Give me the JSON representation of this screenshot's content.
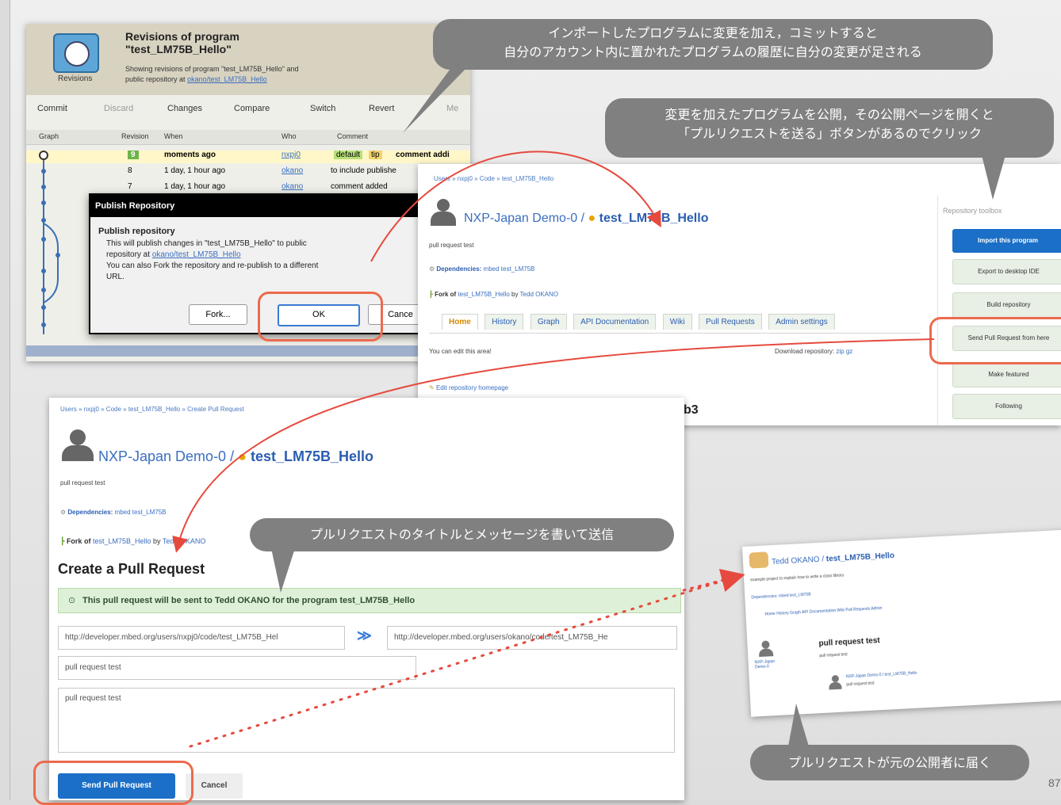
{
  "colors": {
    "accent": "#1b6fc7",
    "highlight": "#ec6a4d",
    "callout": "#808080",
    "success_bg": "#dff0d8"
  },
  "page_number": "87",
  "callouts": {
    "c1": "インポートしたプログラムに変更を加え，コミットすると\n自分のアカウント内に置かれたプログラムの履歴に自分の変更が足される",
    "c2": "変更を加えたプログラムを公開，その公開ページを開くと\n「プルリクエストを送る」ボタンがあるのでクリック",
    "c3": "プルリクエストのタイトルとメッセージを書いて送信",
    "c4": "プルリクエストが元の公開者に届く"
  },
  "revisions_window": {
    "caption": "Revisions",
    "title_line1": "Revisions of program",
    "title_line2": "\"test_LM75B_Hello\"",
    "desc_line1": "Showing revisions of program \"test_LM75B_Hello\" and",
    "desc_line2": "public repository at",
    "desc_link": "okano/test_LM75B_Hello",
    "toolbar": [
      "Commit",
      "Discard",
      "Changes",
      "Compare",
      "Switch",
      "Revert",
      "Me"
    ],
    "columns": [
      "Graph",
      "Revision",
      "When",
      "Who",
      "Comment"
    ],
    "rows": [
      {
        "rev": "9",
        "when": "moments ago",
        "who": "nxpj0",
        "comment": "comment addi",
        "tags": [
          "default",
          "tip"
        ]
      },
      {
        "rev": "8",
        "when": "1 day, 1 hour ago",
        "who": "okano",
        "comment": "to include publishe"
      },
      {
        "rev": "7",
        "when": "1 day, 1 hour ago",
        "who": "okano",
        "comment": "comment added"
      }
    ]
  },
  "publish_dialog": {
    "titlebar": "Publish Repository",
    "heading": "Publish repository",
    "text1": "This will publish changes in \"test_LM75B_Hello\" to public",
    "text2": "repository at",
    "link": "okano/test_LM75B_Hello",
    "text3": "You can also Fork the repository and re-publish to a different",
    "text4": "URL.",
    "btn_fork": "Fork...",
    "btn_ok": "OK",
    "btn_cancel": "Cance"
  },
  "repo_page": {
    "breadcrumb": "Users » nxpj0 » Code » test_LM75B_Hello",
    "owner": "NXP-Japan Demo-0 /",
    "program": "test_LM75B_Hello",
    "desc": "pull request test",
    "dependencies_label": "Dependencies:",
    "dependencies": "mbed   test_LM75B",
    "fork_prefix": "Fork of",
    "fork_link": "test_LM75B_Hello",
    "fork_by": "by",
    "fork_author": "Tedd OKANO",
    "tabs": [
      "Home",
      "History",
      "Graph",
      "API Documentation",
      "Wiki",
      "Pull Requests",
      "Admin settings"
    ],
    "edit_text": "You can edit this area!",
    "download": "Download repository:",
    "download_links": "zip  gz",
    "edit_homepage": "Edit repository homepage",
    "heading_fragment": "b3",
    "toolbox_title": "Repository toolbox",
    "toolbox": [
      "Import this program",
      "Export to desktop IDE",
      "Build repository",
      "Send Pull Request from here",
      "Make featured",
      "Following"
    ]
  },
  "pull_page": {
    "breadcrumb": "Users » nxpj0 » Code » test_LM75B_Hello » Create Pull Request",
    "owner": "NXP-Japan Demo-0 /",
    "program": "test_LM75B_Hello",
    "desc": "pull request test",
    "dependencies_label": "Dependencies:",
    "dependencies": "mbed   test_LM75B",
    "fork_prefix": "Fork of",
    "fork_link": "test_LM75B_Hello",
    "fork_by": "by",
    "fork_author": "Tedd OKANO",
    "heading": "Create a Pull Request",
    "notice": "This pull request will be sent to Tedd OKANO for the program test_LM75B_Hello",
    "from_url": "http://developer.mbed.org/users/nxpj0/code/test_LM75B_Hel",
    "to_url": "http://developer.mbed.org/users/okano/code/test_LM75B_He",
    "title_value": "pull request test",
    "message_value": "pull request test",
    "send_button": "Send Pull Request",
    "cancel_button": "Cancel"
  },
  "received_page": {
    "owner": "Tedd OKANO /",
    "program": "test_LM75B_Hello",
    "desc": "example project to explain how to write a class library",
    "dependencies": "Dependencies:   mbed   test_LM75B",
    "tabs": "Home   History   Graph   API Documentation   Wiki   Pull Requests   Admin",
    "user": "NXP-Japan Demo-0",
    "pr_title": "pull request test",
    "pr_sub": "pull request test",
    "pr_item": "NXP-Japan Demo-0 / test_LM75B_Hello",
    "pr_item_sub": "pull request test"
  }
}
